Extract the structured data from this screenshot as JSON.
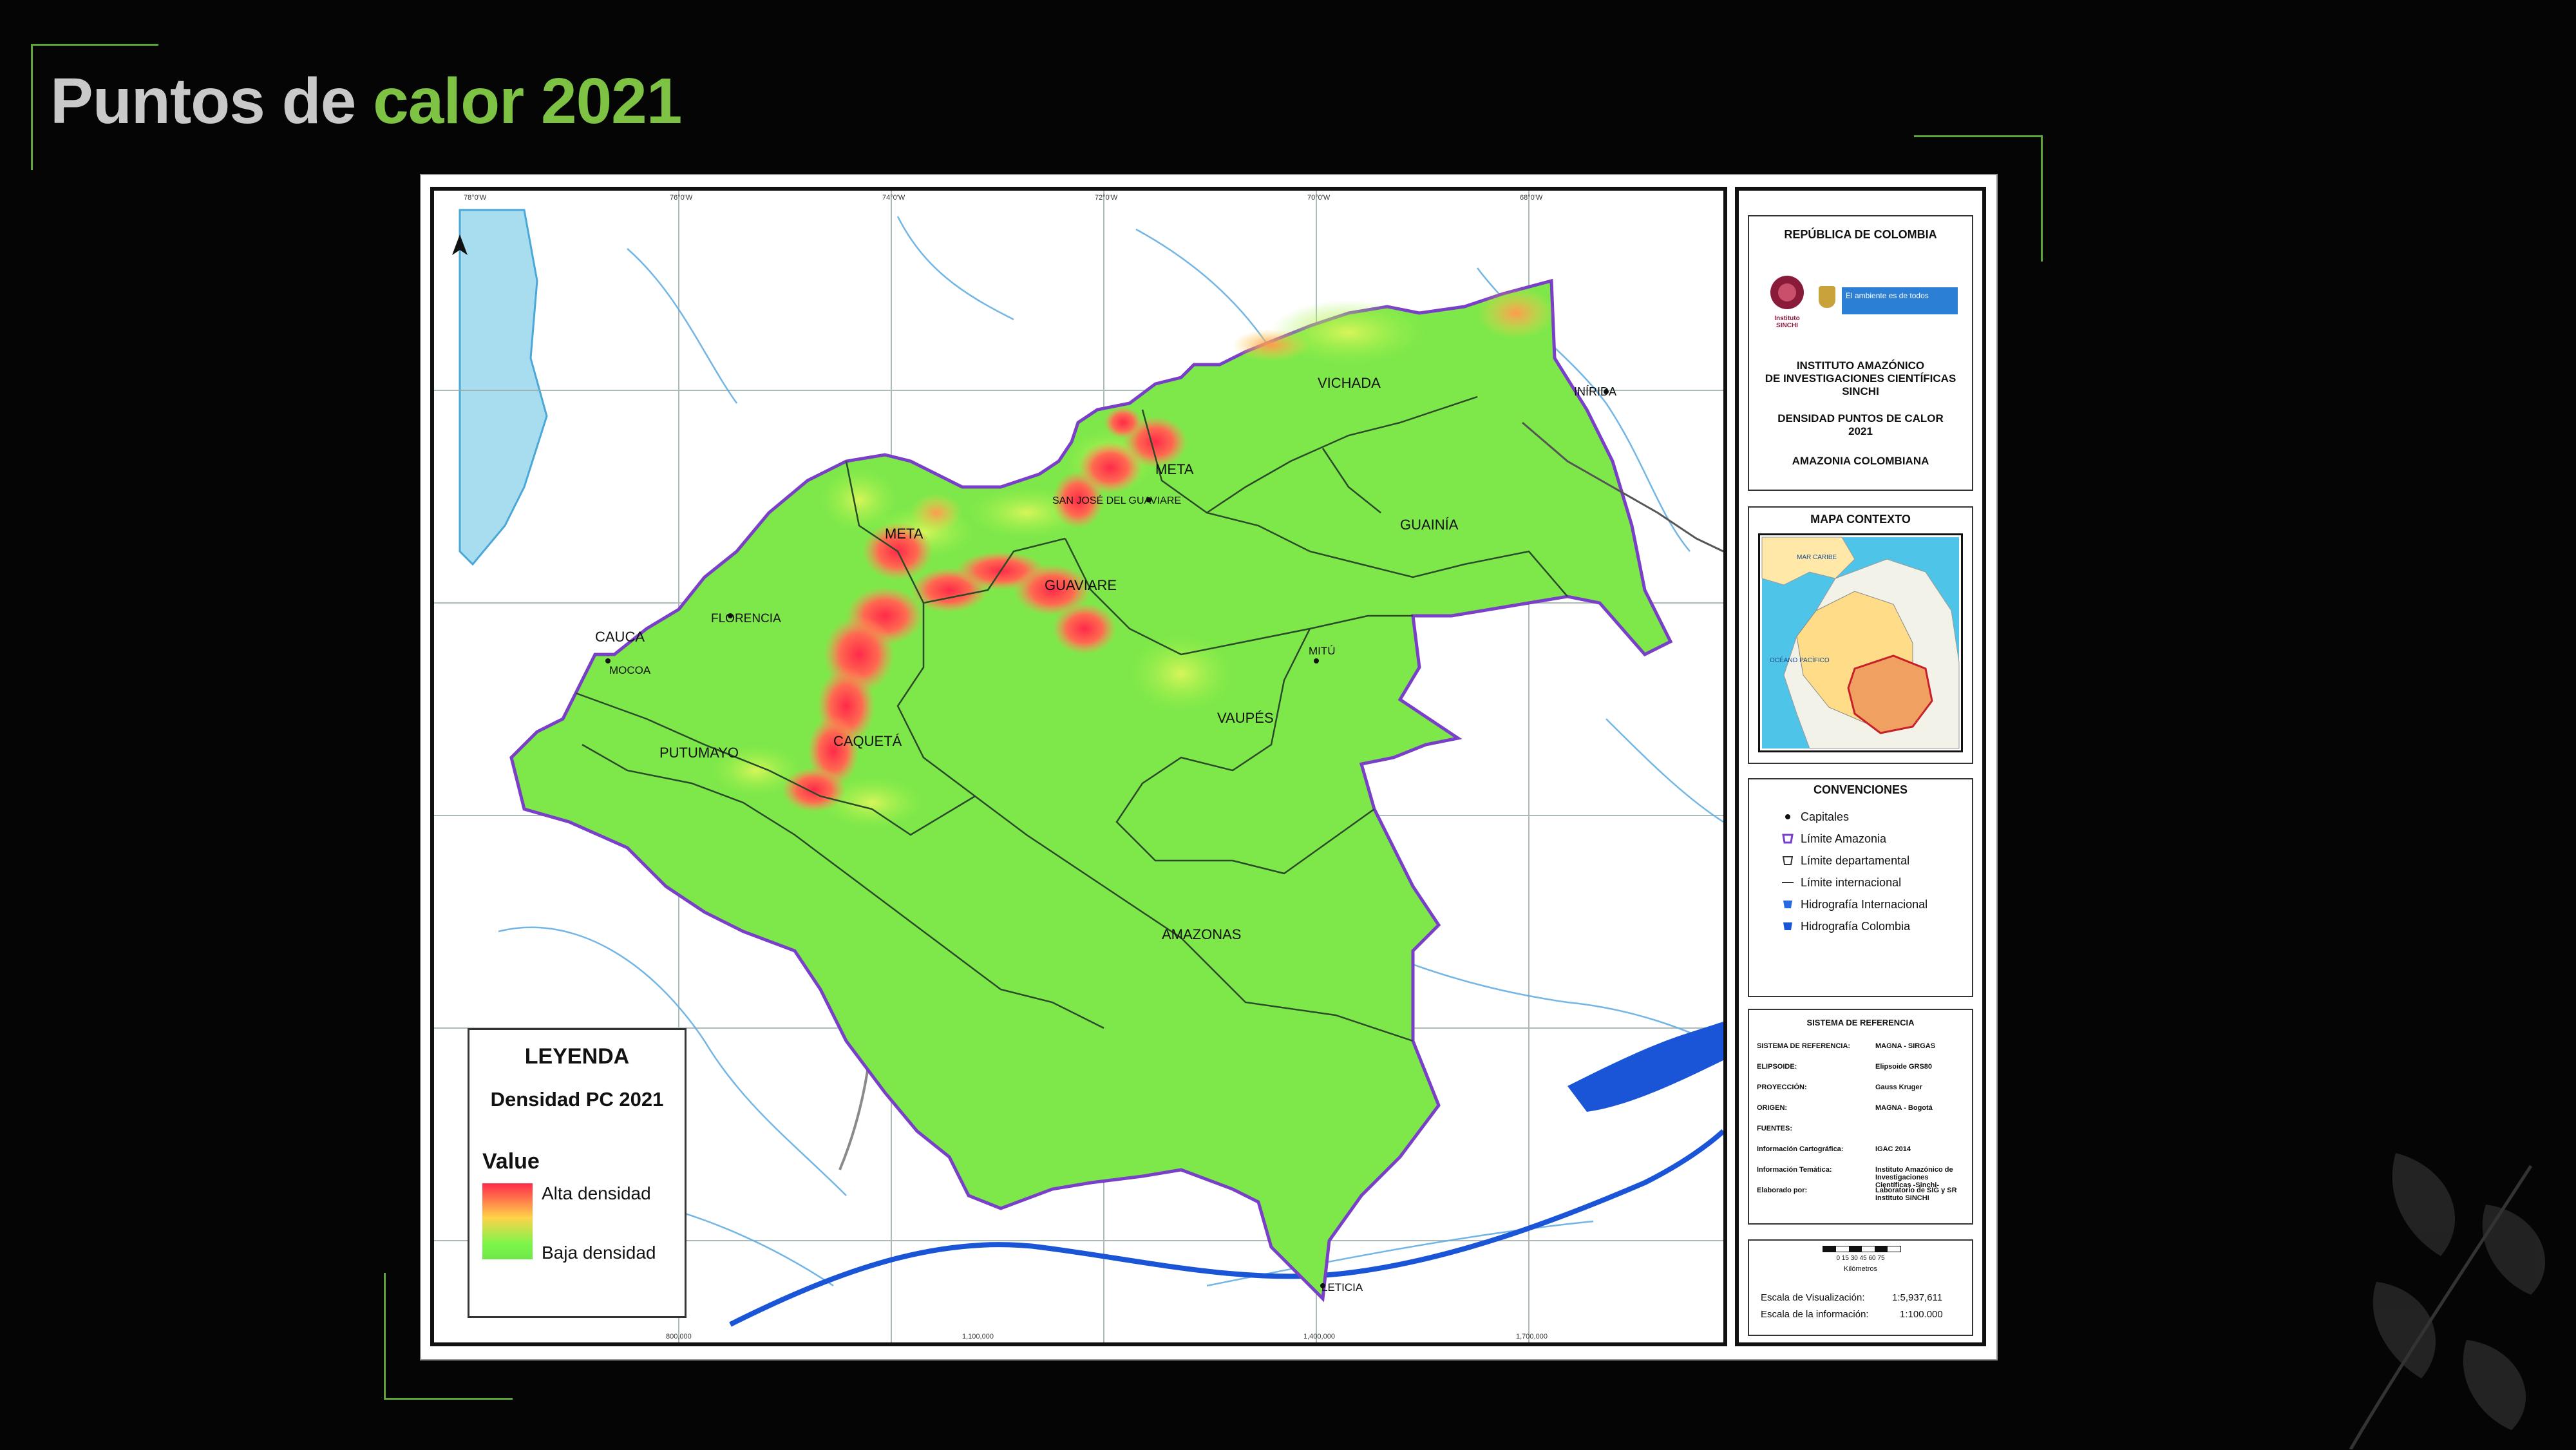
{
  "slide": {
    "title_prefix": "Puntos de",
    "title_accent": "calor 2021",
    "accent_color": "#7dc242"
  },
  "map": {
    "north_arrow_icon": "north-arrow-icon",
    "labels": {
      "vichada": "VICHADA",
      "inirida": "INÍRIDA",
      "meta_north": "META",
      "san_jose": "SAN JOSÉ DEL GUAVIARE",
      "meta_west": "META",
      "guainia": "GUAINÍA",
      "guaviare": "GUAVIARE",
      "florencia": "FLORENCIA",
      "cauca": "CAUCA",
      "mocoa": "MOCOA",
      "mitu": "MITÚ",
      "vaupes": "VAUPÉS",
      "putumayo": "PUTUMAYO",
      "caqueta": "CAQUETÁ",
      "amazonas": "AMAZONAS",
      "leticia": "LETICIA"
    },
    "grid_top": [
      "78°0'W",
      "76°0'W",
      "74°0'W",
      "72°0'W",
      "70°0'W",
      "68°0'W"
    ],
    "grid_bottom": [
      "800,000",
      "1,100,000",
      "1,400,000",
      "1,700,000"
    ]
  },
  "legend": {
    "title": "LEYENDA",
    "subtitle": "Densidad PC 2021",
    "value_label": "Value",
    "high": "Alta densidad",
    "low": "Baja densidad",
    "high_color": "#ff2a4a",
    "low_color": "#6ee84a"
  },
  "side": {
    "republic": "REPÚBLICA DE COLOMBIA",
    "logo_text": "Instituto SINCHI",
    "gov_text": "El ambiente es de todos",
    "institute_line1": "INSTITUTO AMAZÓNICO",
    "institute_line2": "DE INVESTIGACIONES CIENTÍFICAS",
    "institute_line3": "SINCHI",
    "density_line1": "DENSIDAD PUNTOS DE CALOR",
    "density_line2": "2021",
    "region": "AMAZONIA COLOMBIANA",
    "context_title": "MAPA CONTEXTO",
    "context_caribe": "MAR CARIBE",
    "context_pacific": "OCÉANO PACÍFICO",
    "conventions_title": "CONVENCIONES",
    "conventions": [
      {
        "label": "Capitales",
        "icon": "capital-dot-icon"
      },
      {
        "label": "Límite Amazonia",
        "icon": "amazon-limit-icon"
      },
      {
        "label": "Límite departamental",
        "icon": "department-limit-icon"
      },
      {
        "label": "Límite internacional",
        "icon": "international-limit-icon"
      },
      {
        "label": "Hidrografía Internacional",
        "icon": "hydro-international-icon"
      },
      {
        "label": "Hidrografía Colombia",
        "icon": "hydro-colombia-icon"
      }
    ],
    "ref_title": "SISTEMA DE REFERENCIA",
    "ref_rows": [
      {
        "k": "SISTEMA DE REFERENCIA:",
        "v": "MAGNA - SIRGAS"
      },
      {
        "k": "ELIPSOIDE:",
        "v": "Elipsoide GRS80"
      },
      {
        "k": "PROYECCIÓN:",
        "v": "Gauss Kruger"
      },
      {
        "k": "ORIGEN:",
        "v": "MAGNA - Bogotá"
      },
      {
        "k": "FUENTES:",
        "v": ""
      },
      {
        "k": "Información Cartográfica:",
        "v": "IGAC 2014"
      },
      {
        "k": "Información Temática:",
        "v": "Instituto Amazónico de Investigaciones Científicas -Sinchi-"
      },
      {
        "k": "Elaborado por:",
        "v": "Laboratorio de SIG y SR Instituto SINCHI"
      }
    ],
    "scale_ticks": "0 15 30 45 60 75",
    "scale_unit": "Kilómetros",
    "scale_visual_label": "Escala de Visualización:",
    "scale_visual_value": "1:5,937,611",
    "scale_info_label": "Escala de la información:",
    "scale_info_value": "1:100.000"
  }
}
